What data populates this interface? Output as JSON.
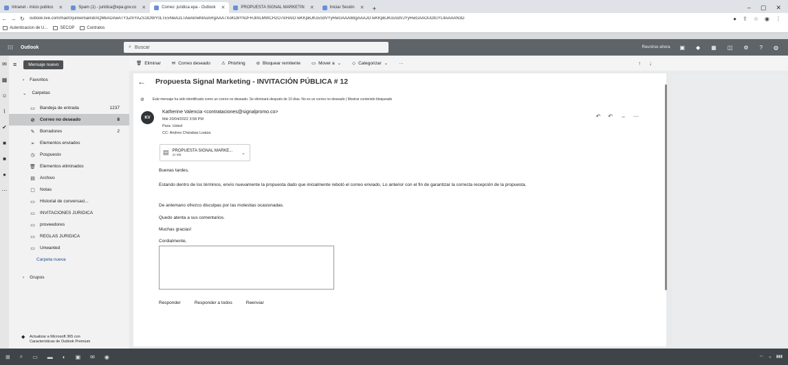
{
  "browser": {
    "tabs": [
      {
        "label": "Intranet - Inicio publico",
        "active": false
      },
      {
        "label": "Spam (1) - juridica@epa.gov.co",
        "active": false
      },
      {
        "label": "Correo: juridica epa - Outlook",
        "active": true
      },
      {
        "label": "PROPUESTA SIGNAL MARKETIN",
        "active": false
      },
      {
        "label": "Iniciar Sesión",
        "active": false
      }
    ],
    "url": "outlook.live.com/mail/0/junkemail/id/AQMkADAwATY3ZmYAZS1lOWY0LTE5NwA2LTAwAi0wMAoARgAAA7XoKD8YN2FRJlmLMWCH2O7lcHAIOTeKKpBJKs5SdVYyRwGAAAIBIgAAAJOTeKKpBJKs5SdVJYyRwGAAOUDtGYL4AAAAN3D",
    "bookmarks": [
      "Autenticacion de U...",
      "SECOP",
      "Contratos"
    ]
  },
  "header": {
    "app_name": "Outlook",
    "search_placeholder": "Buscar",
    "meet_now": "Reunirse ahora"
  },
  "toolbar": {
    "new_mail": "Mensaje nuevo",
    "delete": "Eliminar",
    "not_junk": "Correo deseado",
    "phishing": "Phishing",
    "block": "Bloquear remitente",
    "move": "Mover a",
    "categorize": "Categorizar",
    "more": "···"
  },
  "folders": {
    "favorites": "Favoritos",
    "folders_head": "Carpetas",
    "items": [
      {
        "label": "Bandeja de entrada",
        "count": "1237",
        "icon": "inbox-icon",
        "glyph": "▭"
      },
      {
        "label": "Correo no deseado",
        "count": "8",
        "icon": "junk-icon",
        "glyph": "⊘",
        "selected": true
      },
      {
        "label": "Borradores",
        "count": "2",
        "icon": "pencil-icon",
        "glyph": "✎"
      },
      {
        "label": "Elementos enviados",
        "count": "",
        "icon": "send-icon",
        "glyph": "➢"
      },
      {
        "label": "Pospuesto",
        "count": "",
        "icon": "clock-icon",
        "glyph": "◷"
      },
      {
        "label": "Elementos eliminados",
        "count": "",
        "icon": "trash-icon",
        "glyph": "🗑"
      },
      {
        "label": "Archivo",
        "count": "",
        "icon": "archive-icon",
        "glyph": "▤"
      },
      {
        "label": "Notas",
        "count": "",
        "icon": "note-icon",
        "glyph": "▢"
      },
      {
        "label": "Historial de conversaci...",
        "count": "",
        "icon": "folder-icon",
        "glyph": "▭"
      },
      {
        "label": "INVITACIONES JURIDICA",
        "count": "",
        "icon": "folder-icon",
        "glyph": "▭"
      },
      {
        "label": "proveedores",
        "count": "",
        "icon": "folder-icon",
        "glyph": "▭"
      },
      {
        "label": "REGLAS JURIDICA",
        "count": "",
        "icon": "folder-icon",
        "glyph": "▭"
      },
      {
        "label": "Unwanted",
        "count": "",
        "icon": "folder-icon",
        "glyph": "▭"
      }
    ],
    "new_folder": "Carpeta nueva",
    "groups": "Grupos",
    "upgrade": "Actualizar a Microsoft 365 con Características de Outlook Premium"
  },
  "message": {
    "subject": "Propuesta Signal Marketing - INVITACIÓN PÚBLICA # 12",
    "junk_notice": "Este mensaje ha sido identificado como un correo no deseado. Se eliminará después de 10 días. No es un correo no deseado | Mostrar contenido bloqueado",
    "avatar_initials": "KV",
    "sender": "Katherine Valencia <contrataciones@signalpromo.co>",
    "date": "Mié 20/04/2022 3:58 PM",
    "to": "Para: Usted",
    "cc": "CC: Andres Chizabas Loaiza",
    "attachment_name": "PROPUESTA SIGNAL MARKE...",
    "attachment_size": "22 MB",
    "greeting": "Buenas tardes,",
    "para1": "Estando dentro de los términos, envío nuevamente la propuesta dado que inicialmente rebotó el correo enviado, Lo anterior con el fin de garantizar la correcta recepción de la propuesta.",
    "para2": "De antemano ofrezco disculpas por las molestias ocasionadas.",
    "para3": "Quedo atenta a sus comentarios.",
    "para4": "Muchas gracias!",
    "closing": "Cordialmente,",
    "reply": "Responder",
    "reply_all": "Responder a todos",
    "forward": "Reenviar"
  }
}
